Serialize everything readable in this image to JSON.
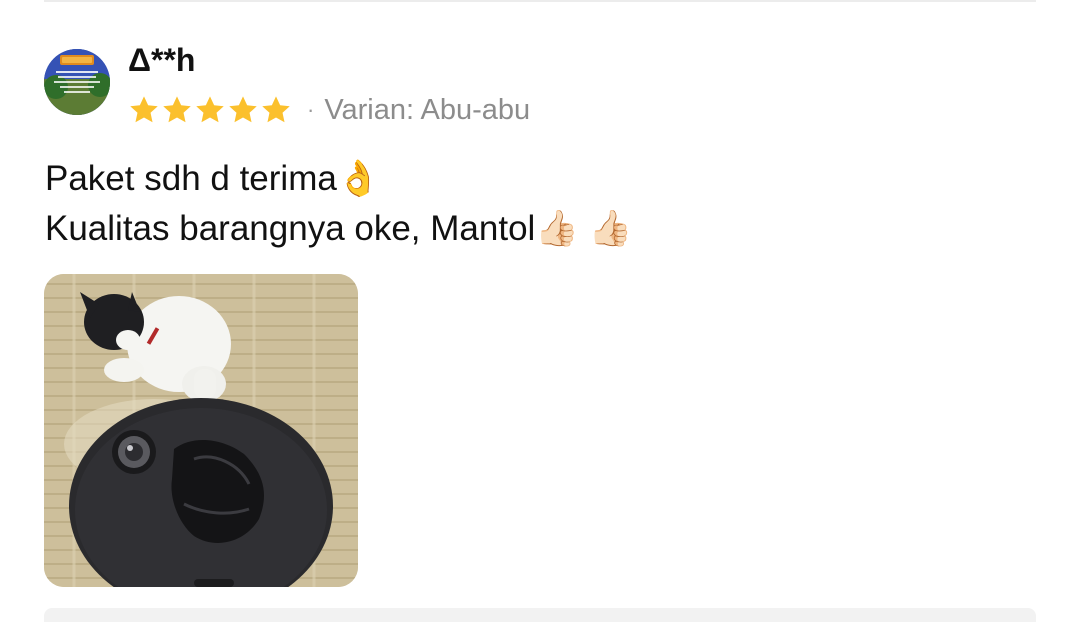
{
  "review": {
    "username": "Δ**h",
    "rating": 5,
    "rating_max": 5,
    "separator": "·",
    "variant": "Varian: Abu-abu",
    "text_lines": [
      "Paket sdh d terima👌",
      "Kualitas barangnya oke, Mantol👍🏻 👍🏻"
    ],
    "star_color": "#FBC02D",
    "avatar_icon": "profile-avatar-image",
    "photo_icon": "review-photo-cat-and-robot-vacuum"
  }
}
